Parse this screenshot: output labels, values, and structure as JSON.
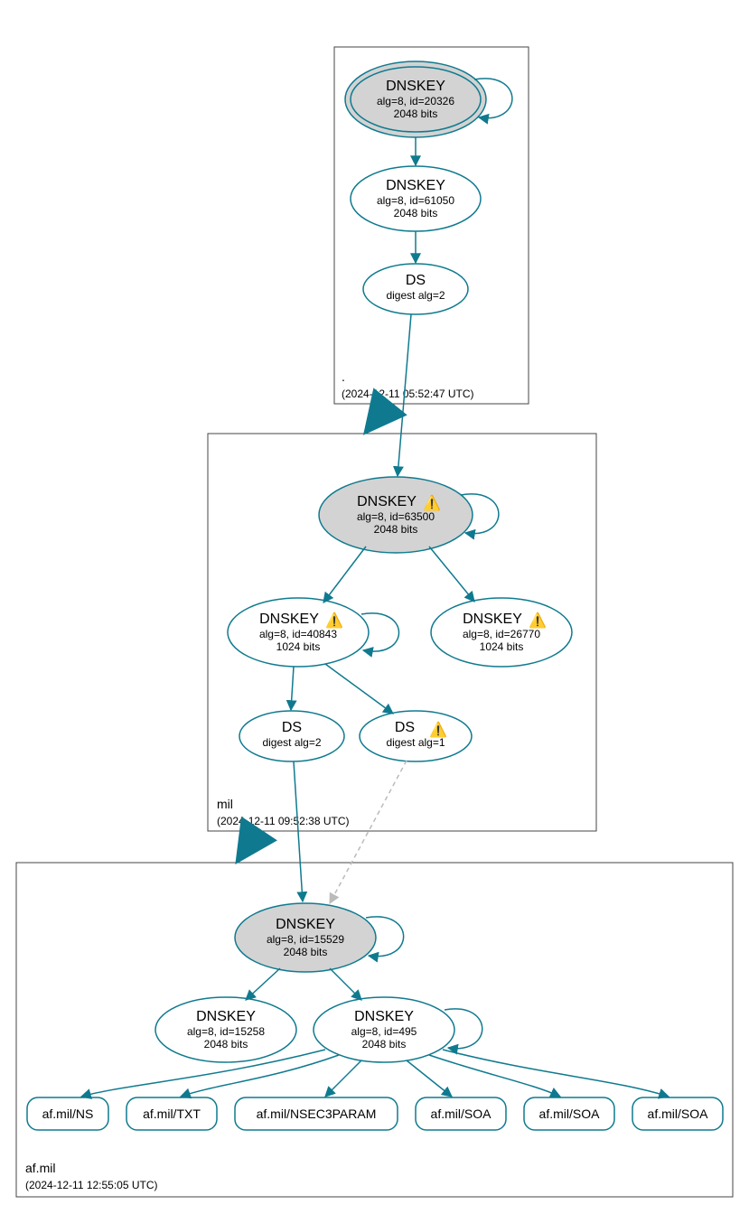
{
  "zones": {
    "root": {
      "label": ".",
      "timestamp": "(2024-12-11 05:52:47 UTC)",
      "nodes": {
        "ksk": {
          "title": "DNSKEY",
          "line1": "alg=8, id=20326",
          "line2": "2048 bits"
        },
        "zsk": {
          "title": "DNSKEY",
          "line1": "alg=8, id=61050",
          "line2": "2048 bits"
        },
        "ds": {
          "title": "DS",
          "line1": "digest alg=2"
        }
      }
    },
    "mil": {
      "label": "mil",
      "timestamp": "(2024-12-11 09:52:38 UTC)",
      "nodes": {
        "ksk": {
          "title": "DNSKEY",
          "line1": "alg=8, id=63500",
          "line2": "2048 bits",
          "warn": true
        },
        "zsk1": {
          "title": "DNSKEY",
          "line1": "alg=8, id=40843",
          "line2": "1024 bits",
          "warn": true
        },
        "zsk2": {
          "title": "DNSKEY",
          "line1": "alg=8, id=26770",
          "line2": "1024 bits",
          "warn": true
        },
        "ds2": {
          "title": "DS",
          "line1": "digest alg=2"
        },
        "ds1": {
          "title": "DS",
          "line1": "digest alg=1",
          "warn": true
        }
      }
    },
    "afmil": {
      "label": "af.mil",
      "timestamp": "(2024-12-11 12:55:05 UTC)",
      "nodes": {
        "ksk": {
          "title": "DNSKEY",
          "line1": "alg=8, id=15529",
          "line2": "2048 bits"
        },
        "zsk1": {
          "title": "DNSKEY",
          "line1": "alg=8, id=15258",
          "line2": "2048 bits"
        },
        "zsk2": {
          "title": "DNSKEY",
          "line1": "alg=8, id=495",
          "line2": "2048 bits"
        }
      },
      "rrsets": {
        "ns": "af.mil/NS",
        "txt": "af.mil/TXT",
        "nsec3": "af.mil/NSEC3PARAM",
        "soa1": "af.mil/SOA",
        "soa2": "af.mil/SOA",
        "soa3": "af.mil/SOA"
      }
    }
  },
  "warn_glyph": "⚠️"
}
